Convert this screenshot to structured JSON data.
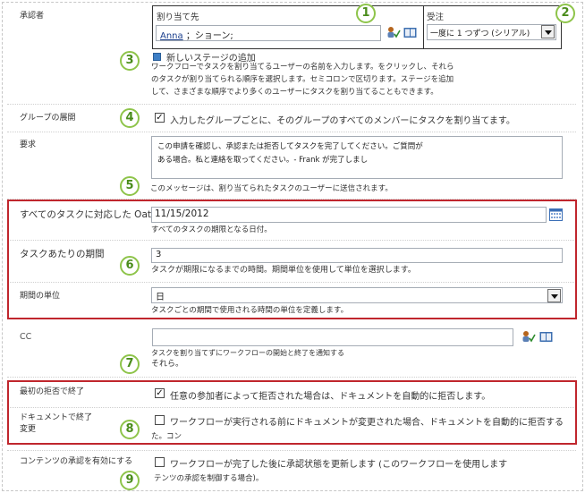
{
  "approvers": {
    "label": "承認者",
    "col_assign": "割り当て先",
    "col_order": "受注",
    "assignee_name": "Anna",
    "assignee_rest": "；ショーン;",
    "order_value": "一度に 1 つずつ (シリアル)",
    "add_stage": "新しいステージの追加",
    "help_lines": [
      "ワークフローでタスクを割り当てるユーザーの名前を入力します。をクリックし、それら",
      "のタスクが割り当てられる順序を選択します。セミコロンで区切ります。ステージを追加",
      "して、さまざまな順序でより多くのユーザーにタスクを割り当てることもできます。"
    ]
  },
  "expand_groups": {
    "label": "グループの展開",
    "checkbox_text": "入力したグループごとに、そのグループのすべてのメンバーにタスクを割り当てます。",
    "checked": true
  },
  "request": {
    "label": "要求",
    "text_lines": [
      "この申請を確認し、承認または拒否してタスクを完了してください。ご質問が",
      "ある場合。私と連絡を取ってください。- Frank が完了しまし"
    ],
    "help": "このメッセージは、割り当てられたタスクのユーザーに送信されます。"
  },
  "due_date": {
    "label": "すべてのタスクに対応した Oaten",
    "value": "11/15/2012",
    "help": "すべてのタスクの期限となる日付。"
  },
  "duration": {
    "label": "タスクあたりの期間",
    "value": "3",
    "help": "タスクが期限になるまでの時間。期間単位を使用して単位を選択します。"
  },
  "duration_units": {
    "label": "期間の単位",
    "value": "日",
    "help": "タスクごとの期間で使用される時間の単位を定義します。"
  },
  "cc": {
    "label": "CC",
    "help_lines": [
      "タスクを割り当てずにワークフローの開始と終了を通知する",
      "それら。"
    ]
  },
  "end_on_reject": {
    "label": "最初の拒否で終了",
    "checkbox_text": "任意の参加者によって拒否された場合は、ドキュメントを自動的に拒否します。",
    "checked": true
  },
  "end_on_change": {
    "label_lines": [
      "ドキュメントで終了",
      "変更"
    ],
    "checkbox_text": "ワークフローが実行される前にドキュメントが変更された場合、ドキュメントを自動的に拒否する",
    "checkbox_text2": "た。コン",
    "checked": false
  },
  "content_approval": {
    "label": "コンテンツの承認を有効にする",
    "checkbox_text": "ワークフローが完了した後に承認状態を更新します (このワークフローを使用します",
    "checkbox_text2": "テンツの承認を制御する場合)。",
    "checked": false
  },
  "callouts": [
    "1",
    "2",
    "3",
    "4",
    "5",
    "6",
    "7",
    "8",
    "9"
  ],
  "colors": {
    "callout_border": "#8ec44a",
    "callout_text": "#4a8c1c",
    "highlight_box": "#c0262d",
    "calendar_icon": "#3b6fb6"
  }
}
